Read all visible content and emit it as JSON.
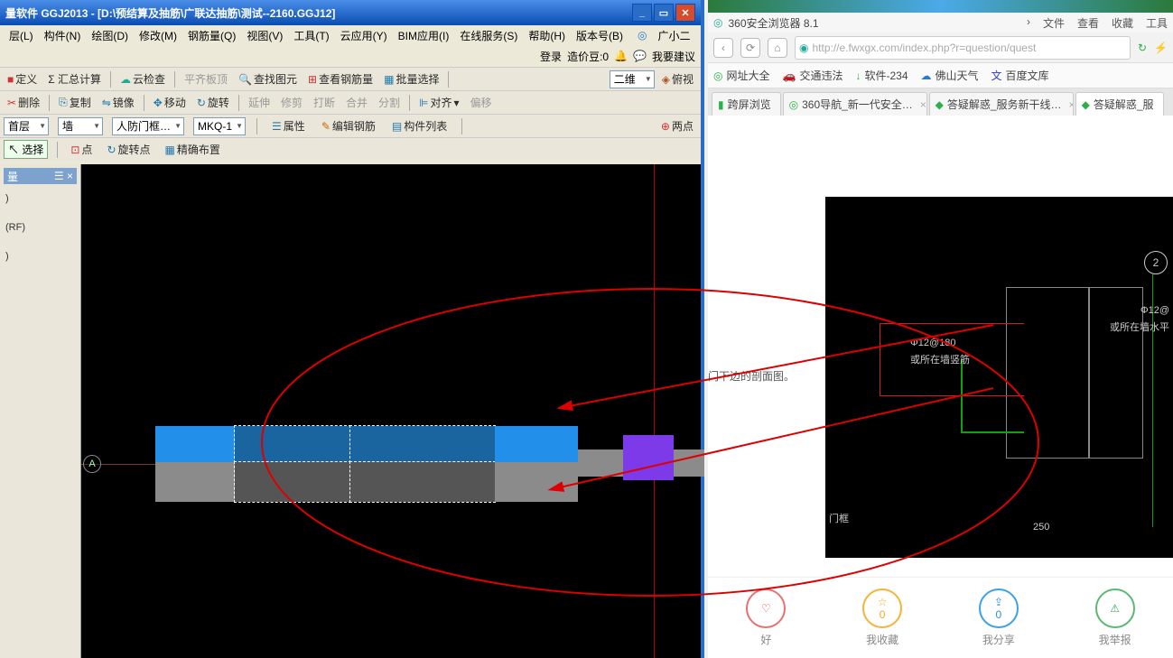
{
  "left": {
    "title": "量软件 GGJ2013 - [D:\\预结算及抽筋\\广联达抽筋\\测试--2160.GGJ12]",
    "menus": [
      "层(L)",
      "构件(N)",
      "绘图(D)",
      "修改(M)",
      "钢筋量(Q)",
      "视图(V)",
      "工具(T)",
      "云应用(Y)",
      "BIM应用(I)",
      "在线服务(S)",
      "帮助(H)",
      "版本号(B)"
    ],
    "login_label": "登录",
    "price_label": "造价豆:0",
    "feedback_label": "我要建议",
    "avatar_label": "广小二",
    "tb1": {
      "define": "定义",
      "sum": "Σ 汇总计算",
      "cloud": "云检查",
      "flat": "平齐板顶",
      "find": "查找图元",
      "rebar": "查看钢筋量",
      "batch": "批量选择",
      "view2d": "二维",
      "ortho": "俯视"
    },
    "tb2": {
      "delete": "删除",
      "copy": "复制",
      "mirror": "镜像",
      "move": "移动",
      "rotate": "旋转",
      "extend": "延伸",
      "trim": "修剪",
      "break": "打断",
      "merge": "合并",
      "split": "分割",
      "align": "对齐",
      "offset": "偏移"
    },
    "tb3": {
      "floor": "首层",
      "wall": "墙",
      "cat": "人防门框…",
      "id": "MKQ-1",
      "prop": "属性",
      "editrebar": "编辑钢筋",
      "list": "构件列表",
      "twopoint": "两点"
    },
    "tb4": {
      "select": "选择",
      "point": "点",
      "rotpoint": "旋转点",
      "precise": "精确布置"
    },
    "panel": {
      "header": "量",
      "row2": "(RF)",
      "row3": ")"
    },
    "axis": "A"
  },
  "right": {
    "app_title": "360安全浏览器 8.1",
    "menu": [
      "文件",
      "查看",
      "收藏",
      "工具"
    ],
    "url": "http://e.fwxgx.com/index.php?r=question/quest",
    "favs": [
      "网址大全",
      "交通违法",
      "软件-234",
      "佛山天气",
      "百度文库"
    ],
    "tabs": [
      "跨屏浏览",
      "360导航_新一代安全…",
      "答疑解惑_服务新干线…",
      "答疑解惑_服"
    ],
    "page_fragment": "门下边的剖面图。",
    "cad": {
      "label1": "Φ12@180",
      "label2": "或所在墙竖筋",
      "label3": "Φ12@",
      "label4": "或所在墙水平",
      "mk": "门框",
      "dim": "250",
      "axis2": "2"
    },
    "stats": {
      "b_label": "我收藏",
      "b_val": "0",
      "c_label": "我分享",
      "c_val": "0",
      "d_label": "我举报"
    }
  }
}
